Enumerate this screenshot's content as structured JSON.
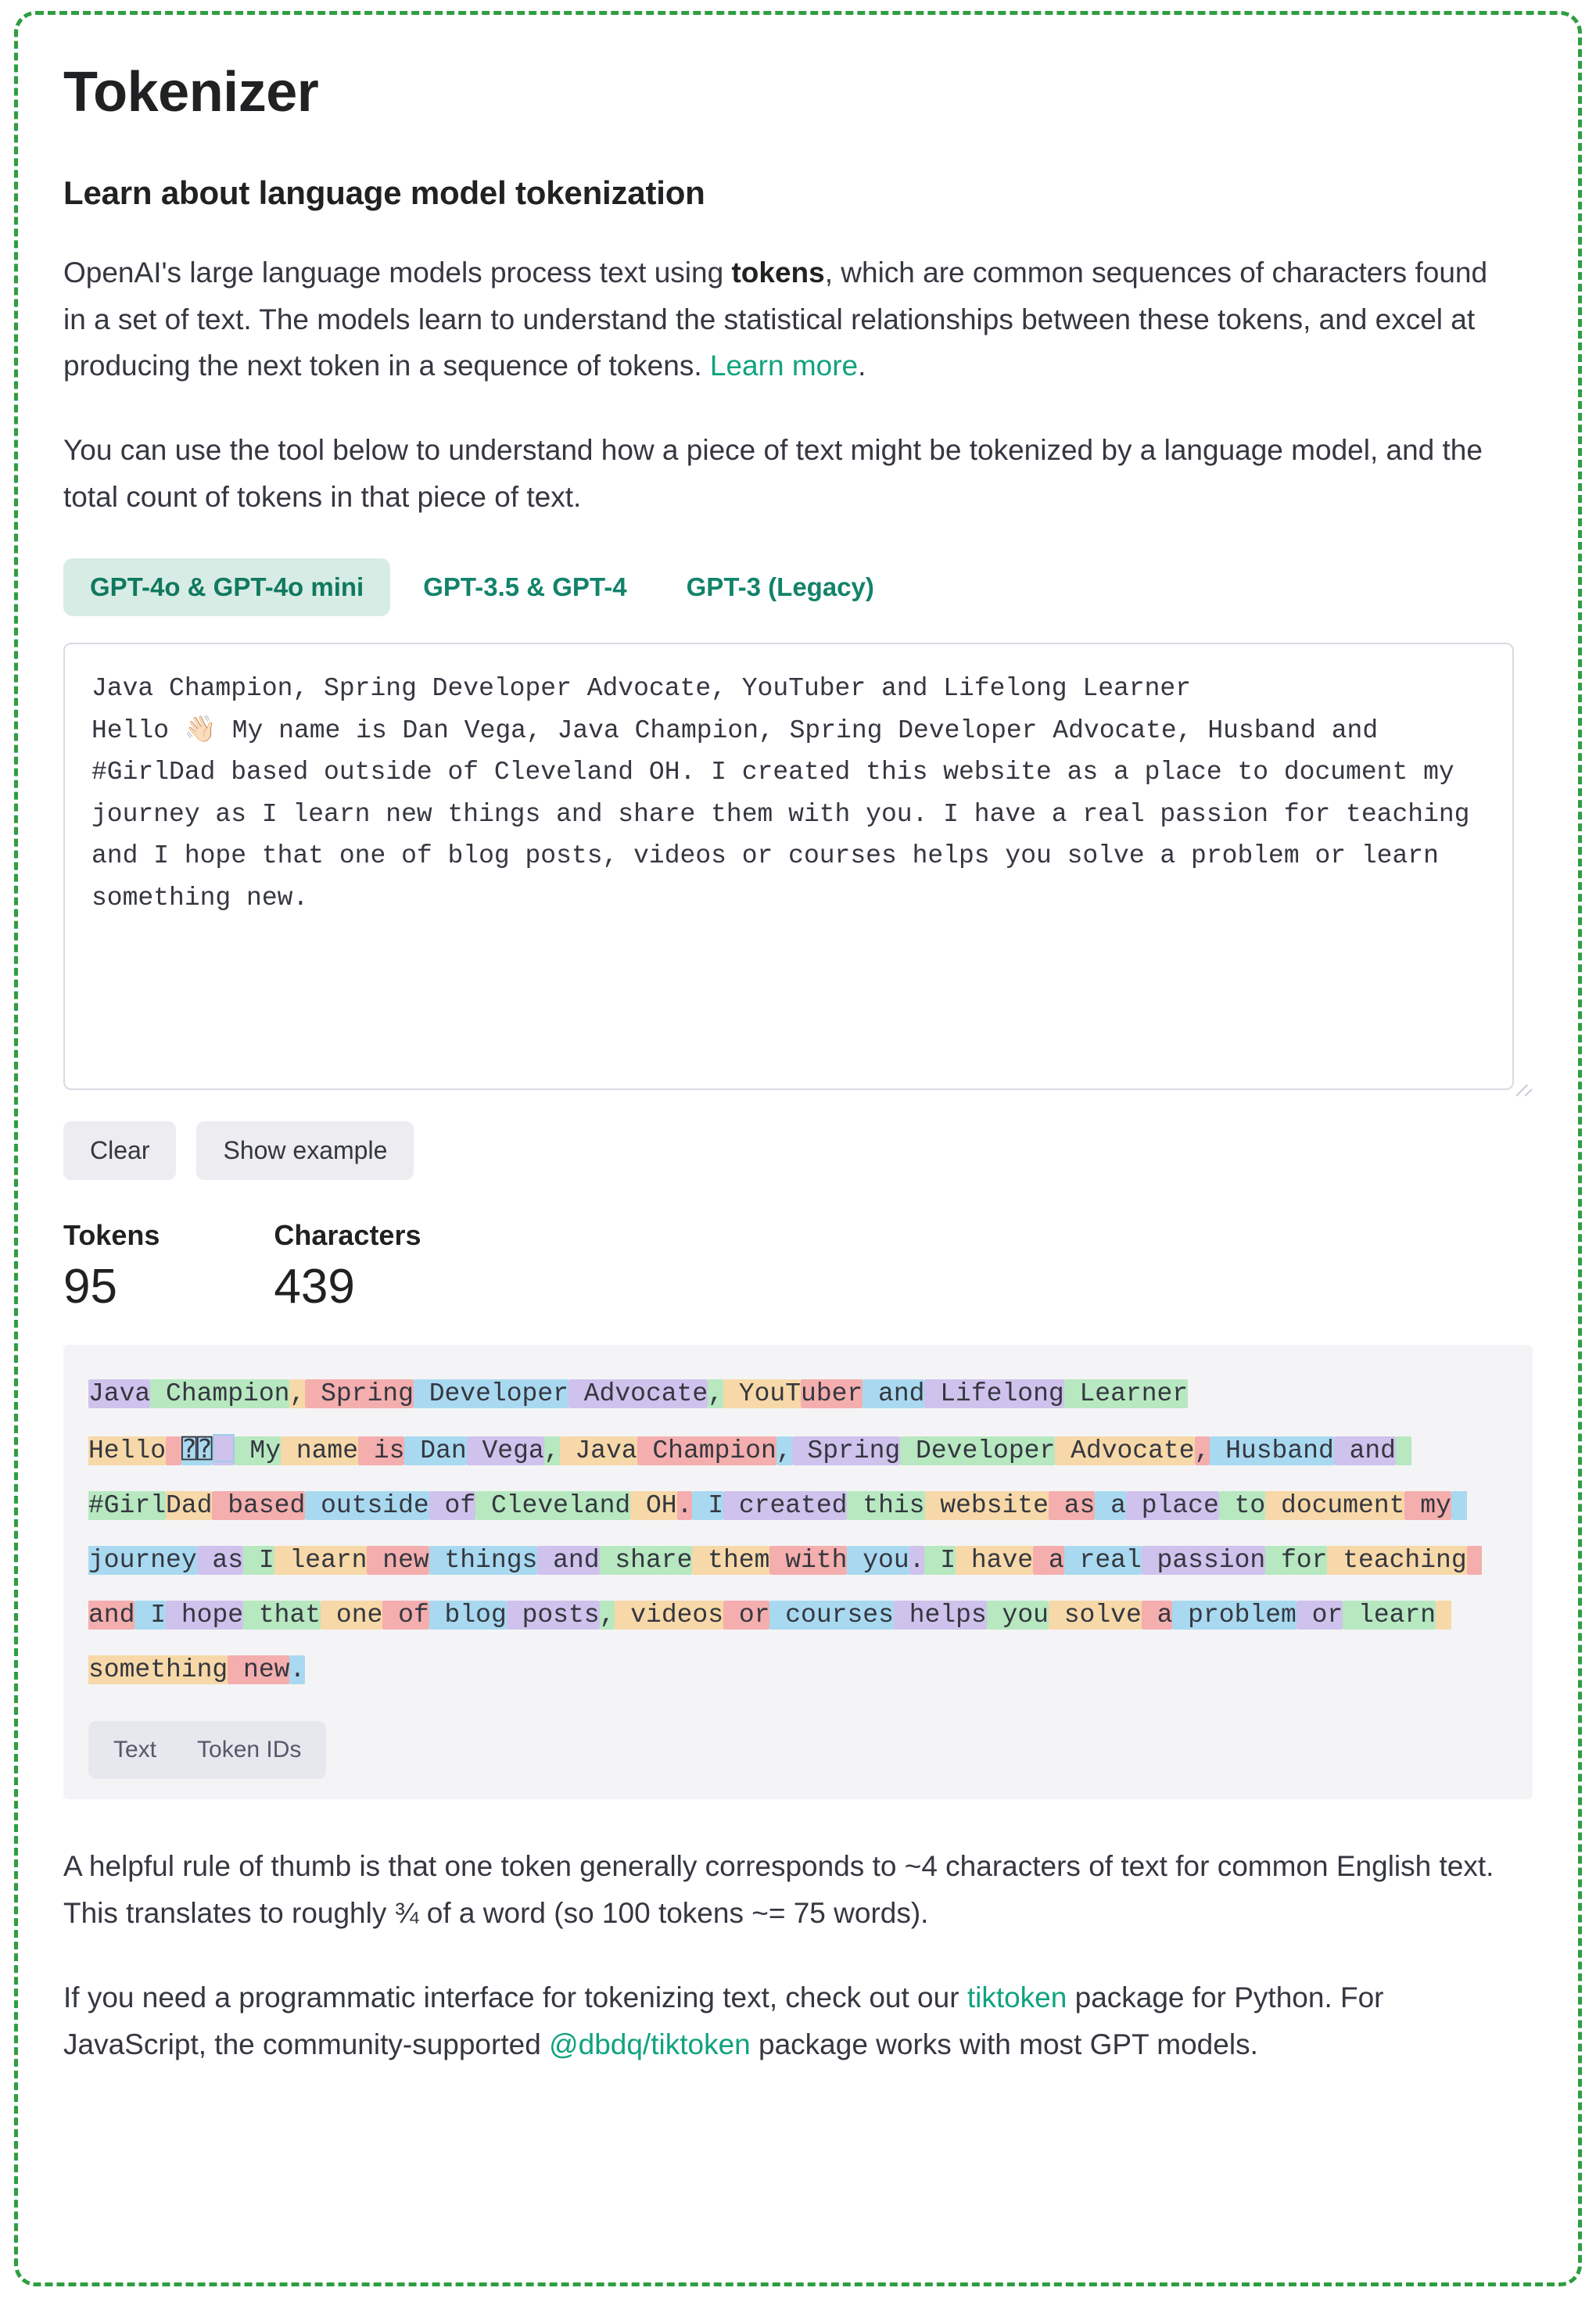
{
  "page": {
    "title": "Tokenizer",
    "subtitle": "Learn about language model tokenization",
    "border_color": "#2f9e41",
    "accent_color": "#10a37f"
  },
  "intro": {
    "part1": "OpenAI's large language models process text using ",
    "bold": "tokens",
    "part2": ", which are common sequences of characters found in a set of text. The models learn to understand the statistical relationships between these tokens, and excel at producing the next token in a sequence of tokens. ",
    "link": "Learn more",
    "part3": ".",
    "paragraph2": "You can use the tool below to understand how a piece of text might be tokenized by a language model, and the total count of tokens in that piece of text."
  },
  "tabs": [
    {
      "label": "GPT-4o & GPT-4o mini",
      "active": true
    },
    {
      "label": "GPT-3.5 & GPT-4",
      "active": false
    },
    {
      "label": "GPT-3 (Legacy)",
      "active": false
    }
  ],
  "textarea": {
    "value": "Java Champion, Spring Developer Advocate, YouTuber and Lifelong Learner\nHello 👋🏻 My name is Dan Vega, Java Champion, Spring Developer Advocate, Husband and #GirlDad based outside of Cleveland OH. I created this website as a place to document my journey as I learn new things and share them with you. I have a real passion for teaching and I hope that one of blog posts, videos or courses helps you solve a problem or learn something new.",
    "placeholder": "Enter some text"
  },
  "buttons": {
    "clear": "Clear",
    "show_example": "Show example"
  },
  "stats": [
    {
      "label": "Tokens",
      "value": "95"
    },
    {
      "label": "Characters",
      "value": "439"
    }
  ],
  "token_colors": [
    "#cfc2ec",
    "#b7e8c0",
    "#f7d8a8",
    "#f4aeae",
    "#a9d9f0"
  ],
  "tokens": [
    "Java",
    " Champion",
    ",",
    " Spring",
    " Developer",
    " Advocate",
    ",",
    " YouT",
    "uber",
    " and",
    " Lifelong",
    " Learner",
    "\nHello",
    " ",
    "EMOJI1",
    "EMOJI2",
    " My",
    " name",
    " is",
    " Dan",
    " Vega",
    ",",
    " Java",
    " Champion",
    ",",
    " Spring",
    " Developer",
    " Advocate",
    ",",
    " Husband",
    " and",
    " #Girl",
    "Dad",
    " based",
    " outside",
    " of",
    " Cleveland",
    " OH",
    ".",
    " I",
    " created",
    " this",
    " website",
    " as",
    " a",
    " place",
    " to",
    " document",
    " my",
    " journey",
    " as",
    " I",
    " learn",
    " new",
    " things",
    " and",
    " share",
    " them",
    " with",
    " you",
    ".",
    " I",
    " have",
    " a",
    " real",
    " passion",
    " for",
    " teaching",
    " and",
    " I",
    " hope",
    " that",
    " one",
    " of",
    " blog",
    " posts",
    ",",
    " videos",
    " or",
    " courses",
    " helps",
    " you",
    " solve",
    " a",
    " problem",
    " or",
    " learn",
    " something",
    " new",
    "."
  ],
  "view_toggle": [
    {
      "label": "Text",
      "selected": true
    },
    {
      "label": "Token IDs",
      "selected": false
    }
  ],
  "footer": {
    "rule_of_thumb": "A helpful rule of thumb is that one token generally corresponds to ~4 characters of text for common English text. This translates to roughly ¾ of a word (so 100 tokens ~= 75 words).",
    "api_part1": "If you need a programmatic interface for tokenizing text, check out our ",
    "api_link1": "tiktoken",
    "api_part2": " package for Python. For JavaScript, the community-supported ",
    "api_link2": "@dbdq/tiktoken",
    "api_part3": " package works with most GPT models."
  }
}
